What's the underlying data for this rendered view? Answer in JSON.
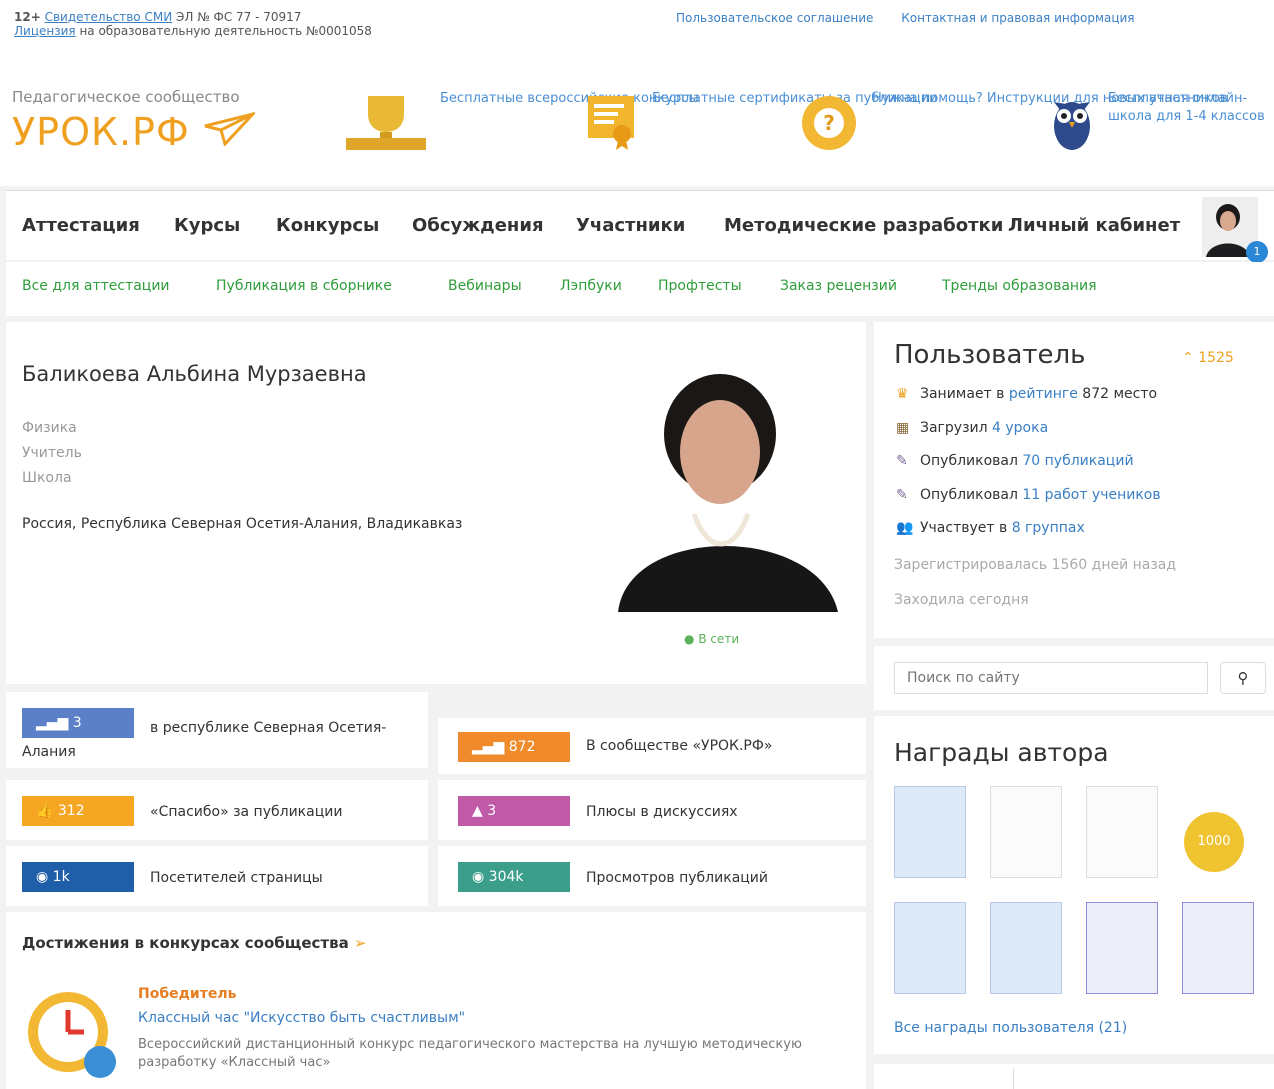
{
  "header": {
    "age": "12+",
    "smi_link": "Свидетельство СМИ",
    "smi_text": "ЭЛ № ФС 77 - 70917",
    "license_link": "Лицензия",
    "license_text": "на образовательную деятельность №0001058",
    "links": [
      "Пользовательское соглашение",
      "Контактная и правовая информация"
    ]
  },
  "brand": {
    "subtitle": "Педагогическое сообщество",
    "name": "УРОК.РФ"
  },
  "promos": [
    {
      "text": "Бесплатные всероссийские конкурсы",
      "icon": "trophy-icon"
    },
    {
      "text": "Бесплатные сертификаты за публикации",
      "icon": "certificate-icon"
    },
    {
      "text": "Нужна помощь? Инструкции для новых участников",
      "icon": "help-lifebuoy-icon"
    },
    {
      "text": "Бесплатная онлайн-школа для 1-4 классов",
      "icon": "owl-icon"
    }
  ],
  "nav": [
    "Аттестация",
    "Курсы",
    "Конкурсы",
    "Обсуждения",
    "Участники",
    "Методические разработки",
    "Личный кабинет"
  ],
  "avatar_badge": "1",
  "subnav": [
    "Все для аттестации",
    "Публикация в сборнике",
    "Вебинары",
    "Лэпбуки",
    "Профтесты",
    "Заказ рецензий",
    "Тренды образования"
  ],
  "profile": {
    "name": "Баликоева Альбина Мурзаевна",
    "subject": "Физика",
    "position": "Учитель",
    "school": "Школа",
    "location": "Россия, Республика Северная Осетия-Алания, Владикавказ",
    "online": "В сети"
  },
  "stats": [
    {
      "value": "3",
      "label": "в республике Северная Осетия-Алания",
      "color": "#5b80c8"
    },
    {
      "value": "872",
      "label": "В сообществе «УРОК.РФ»",
      "color": "#f08a2a"
    },
    {
      "value": "312",
      "label": "«Спасибо» за публикации",
      "color": "#f5a623"
    },
    {
      "value": "3",
      "label": "Плюсы в дискуссиях",
      "color": "#c05aa6"
    },
    {
      "value": "1k",
      "label": "Посетителей страницы",
      "color": "#1f5faa"
    },
    {
      "value": "304k",
      "label": "Просмотров публикаций",
      "color": "#3a9e8a"
    }
  ],
  "achievements": {
    "title": "Достижения в конкурсах сообщества",
    "item": {
      "status": "Победитель",
      "title": "Классный час \"Искусство быть счастливым\"",
      "desc": "Всероссийский дистанционный конкурс педагогического мастерства на лучшую методическую разработку «Классный час»"
    }
  },
  "user": {
    "heading": "Пользователь",
    "score": "1525",
    "rows": [
      {
        "pre": "Занимает в ",
        "link": "рейтинге",
        "post": " 872 место",
        "icon": "crown-icon"
      },
      {
        "pre": "Загрузил ",
        "link": "4 урока",
        "post": "",
        "icon": "box-icon"
      },
      {
        "pre": "Опубликовал ",
        "link": "70 публикаций",
        "post": "",
        "icon": "pen-icon"
      },
      {
        "pre": "Опубликовал ",
        "link": "11 работ учеников",
        "post": "",
        "icon": "pen-icon"
      },
      {
        "pre": "Участвует в ",
        "link": "8 группах",
        "post": "",
        "icon": "group-icon"
      }
    ],
    "registered": "Зарегистрировалась 1560 дней назад",
    "last_seen": "Заходила сегодня"
  },
  "search": {
    "placeholder": "Поиск по сайту"
  },
  "awards": {
    "heading": "Награды автора",
    "all_link": "Все награды пользователя (21)",
    "medal": "1000"
  }
}
